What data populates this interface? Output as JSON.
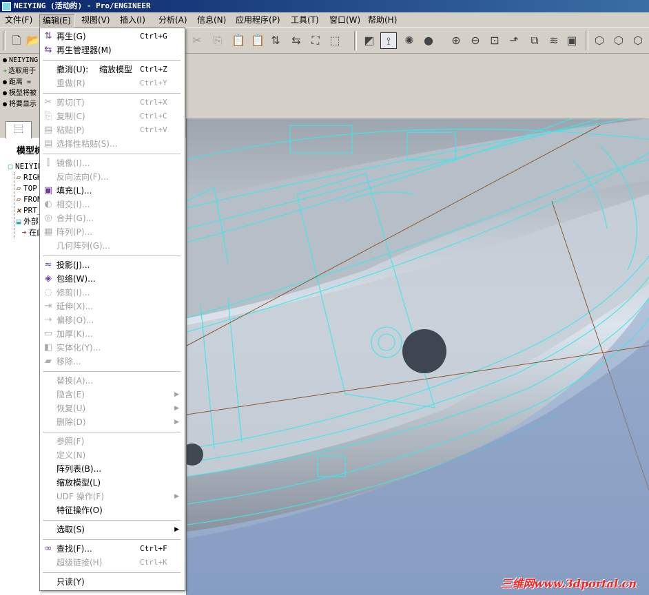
{
  "window": {
    "title": "NEIYING (活动的) - Pro/ENGINEER"
  },
  "menubar": [
    {
      "id": "file",
      "label": "文件(F)"
    },
    {
      "id": "edit",
      "label": "编辑(E)",
      "active": true
    },
    {
      "id": "view",
      "label": "视图(V)"
    },
    {
      "id": "insert",
      "label": "插入(I)"
    },
    {
      "id": "analysis",
      "label": "分析(A)"
    },
    {
      "id": "info",
      "label": "信息(N)"
    },
    {
      "id": "apps",
      "label": "应用程序(P)"
    },
    {
      "id": "tools",
      "label": "工具(T)"
    },
    {
      "id": "window",
      "label": "窗口(W)"
    },
    {
      "id": "help",
      "label": "帮助(H)"
    }
  ],
  "messages": [
    {
      "text": "NEIYING",
      "type": "bullet"
    },
    {
      "text": "选取用于",
      "type": "arrow"
    },
    {
      "text": "距离 =",
      "type": "bullet"
    },
    {
      "text": "模型将被",
      "type": "bullet"
    },
    {
      "text": "将要显示",
      "type": "bullet"
    }
  ],
  "panel": {
    "title": "模型树"
  },
  "tree": [
    {
      "label": "NEIYING",
      "icon": "part"
    },
    {
      "label": "RIGHT",
      "icon": "datum"
    },
    {
      "label": "TOP",
      "icon": "datum"
    },
    {
      "label": "FRONT",
      "icon": "datum"
    },
    {
      "label": "PRT_CSYS_DEF",
      "icon": "csys"
    },
    {
      "label": "外部复制几何",
      "icon": "ext"
    },
    {
      "label": "在此插入",
      "icon": "ins"
    }
  ],
  "edit_menu": [
    {
      "label": "再生(G)",
      "shortcut": "Ctrl+G",
      "icon": "regen-icon",
      "enabled": true
    },
    {
      "label": "再生管理器(M)",
      "icon": "regen-manager-icon",
      "enabled": true
    },
    {
      "separator": true
    },
    {
      "label": "撤消(U):",
      "extra": "缩放模型",
      "shortcut": "Ctrl+Z",
      "enabled": true
    },
    {
      "label": "重做(R)",
      "shortcut": "Ctrl+Y",
      "enabled": false
    },
    {
      "separator": true
    },
    {
      "label": "剪切(T)",
      "shortcut": "Ctrl+X",
      "icon": "scissors-icon",
      "enabled": false
    },
    {
      "label": "复制(C)",
      "shortcut": "Ctrl+C",
      "icon": "copy-icon",
      "enabled": false
    },
    {
      "label": "粘贴(P)",
      "shortcut": "Ctrl+V",
      "icon": "paste-icon",
      "enabled": false
    },
    {
      "label": "选择性粘贴(S)...",
      "icon": "paste-special-icon",
      "enabled": false
    },
    {
      "separator": true
    },
    {
      "label": "镜像(I)...",
      "icon": "mirror-icon",
      "enabled": false
    },
    {
      "label": "反向法向(F)...",
      "enabled": false
    },
    {
      "label": "填充(L)...",
      "icon": "fill-icon",
      "enabled": true
    },
    {
      "label": "相交(I)...",
      "icon": "intersect-icon",
      "enabled": false
    },
    {
      "label": "合并(G)...",
      "icon": "merge-icon",
      "enabled": false
    },
    {
      "label": "阵列(P)...",
      "icon": "pattern-icon",
      "enabled": false
    },
    {
      "label": "几何阵列(G)...",
      "enabled": false
    },
    {
      "separator": true
    },
    {
      "label": "投影(J)...",
      "icon": "project-icon",
      "enabled": true
    },
    {
      "label": "包络(W)...",
      "icon": "wrap-icon",
      "enabled": true
    },
    {
      "label": "修剪(I)...",
      "icon": "trim-icon",
      "enabled": false
    },
    {
      "label": "延伸(X)...",
      "icon": "extend-icon",
      "enabled": false
    },
    {
      "label": "偏移(O)...",
      "icon": "offset-icon",
      "enabled": false
    },
    {
      "label": "加厚(K)...",
      "icon": "thicken-icon",
      "enabled": false
    },
    {
      "label": "实体化(Y)...",
      "icon": "solidify-icon",
      "enabled": false
    },
    {
      "label": "移除...",
      "icon": "remove-icon",
      "enabled": false
    },
    {
      "separator": true
    },
    {
      "label": "替换(A)...",
      "enabled": false
    },
    {
      "label": "隐含(E)",
      "submenu": true,
      "enabled": false
    },
    {
      "label": "恢复(U)",
      "submenu": true,
      "enabled": false
    },
    {
      "label": "删除(D)",
      "submenu": true,
      "enabled": false
    },
    {
      "separator": true
    },
    {
      "label": "参照(F)",
      "enabled": false
    },
    {
      "label": "定义(N)",
      "enabled": false
    },
    {
      "label": "阵列表(B)...",
      "enabled": true
    },
    {
      "label": "缩放模型(L)",
      "enabled": true
    },
    {
      "label": "UDF 操作(F)",
      "submenu": true,
      "enabled": false
    },
    {
      "label": "特征操作(O)",
      "enabled": true
    },
    {
      "separator": true
    },
    {
      "label": "选取(S)",
      "submenu": true,
      "enabled": true
    },
    {
      "separator": true
    },
    {
      "label": "查找(F)...",
      "shortcut": "Ctrl+F",
      "icon": "binoculars-icon",
      "enabled": true
    },
    {
      "label": "超级链接(H)",
      "shortcut": "Ctrl+K",
      "enabled": false
    },
    {
      "separator": true
    },
    {
      "label": "只读(Y)",
      "enabled": true
    }
  ],
  "watermark": "三维网www.3dportal.cn",
  "colors": {
    "wireframe": "#3ee6ea",
    "menu_bg": "#ffffff",
    "disabled": "#a0a0a0",
    "titlebar": "#0a246a"
  }
}
